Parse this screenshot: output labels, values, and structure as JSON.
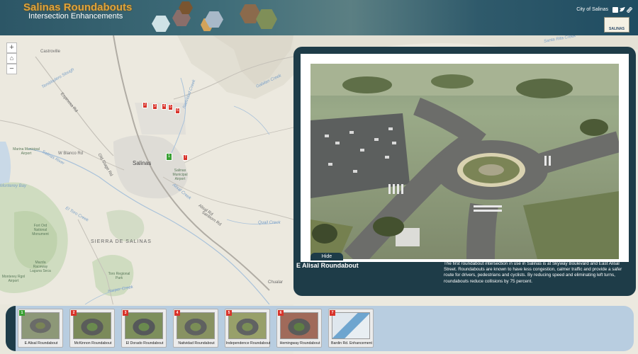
{
  "header": {
    "title": "Salinas Roundabouts",
    "subtitle": "Intersection Enhancements",
    "city_link": "City of Salinas",
    "share_icons": [
      "facebook-icon",
      "twitter-icon",
      "link-icon"
    ],
    "logo_text": "SALINAS"
  },
  "map": {
    "city_label": "Salinas",
    "labels": {
      "castroville": "Castroville",
      "el_blanco": "W Blanco Rd",
      "salinas_river": "Salinas River",
      "marina_airport": "Marina Municipal Airport",
      "salinas_airport": "Salinas Municipal Airport",
      "alisal": "Alisal Creek",
      "santa_rita": "Santa Rita Creek",
      "natividad": "Natividad Creek",
      "gabilan": "Gabilan Creek",
      "sierra": "SIERRA DE SALINAS",
      "fort_ord": "Fort Ord National Monument",
      "toro": "Toro Regional Park",
      "laguna_seca": "Mazda Raceway Laguna Seca",
      "harper": "Harper Creek",
      "el_toro": "El Toro Creek",
      "chualar": "Chualar",
      "quail": "Quail Creek",
      "monterey_airport": "Monterey Rgnl Airport",
      "tembladero": "Tembladero Slough",
      "alisal_road": "Alisal Rd",
      "espinosa": "Espinosa Rd",
      "old_stage": "Old Stage Rd",
      "bay": "Monterey Bay",
      "sanborn": "Sanborn Rd"
    },
    "markers": [
      {
        "num": "1",
        "color": "green"
      },
      {
        "num": "2",
        "color": "red"
      },
      {
        "num": "3",
        "color": "red"
      },
      {
        "num": "4",
        "color": "red"
      },
      {
        "num": "5",
        "color": "red"
      },
      {
        "num": "6",
        "color": "red"
      },
      {
        "num": "7",
        "color": "red"
      }
    ],
    "zoom_in": "+",
    "home": "⌂",
    "zoom_out": "−"
  },
  "panel": {
    "hide_label": "Hide",
    "title": "E Alisal Roundabout",
    "text": "The first roundabout intersection in use in Salinas is at Skyway Boulevard and East Alisal Street. Roundabouts are known to have less congestion, calmer traffic and provide a safer route for drivers, pedestrians and cyclists. By reducing speed and eliminating left turns, roundabouts reduce collisions by 75 percent."
  },
  "carousel": {
    "items": [
      {
        "num": "1",
        "label": "E Alisal Roundabout",
        "color": "green"
      },
      {
        "num": "2",
        "label": "McKinnon Roundabout",
        "color": "red"
      },
      {
        "num": "3",
        "label": "El Dorado Roundabout",
        "color": "red"
      },
      {
        "num": "4",
        "label": "Natividad Roundabout",
        "color": "red"
      },
      {
        "num": "5",
        "label": "Independence Roundabout",
        "color": "red"
      },
      {
        "num": "6",
        "label": "Hemingway Roundabout",
        "color": "red"
      },
      {
        "num": "7",
        "label": "Bardin Rd. Enhancement",
        "color": "red"
      }
    ]
  },
  "colors": {
    "header_bg": "#2c5666",
    "title_color": "#e0a33a",
    "panel_bg": "#1e3c48",
    "marker_red": "#d8332a",
    "marker_green": "#39a032",
    "carousel_bg": "#afc8e1"
  }
}
